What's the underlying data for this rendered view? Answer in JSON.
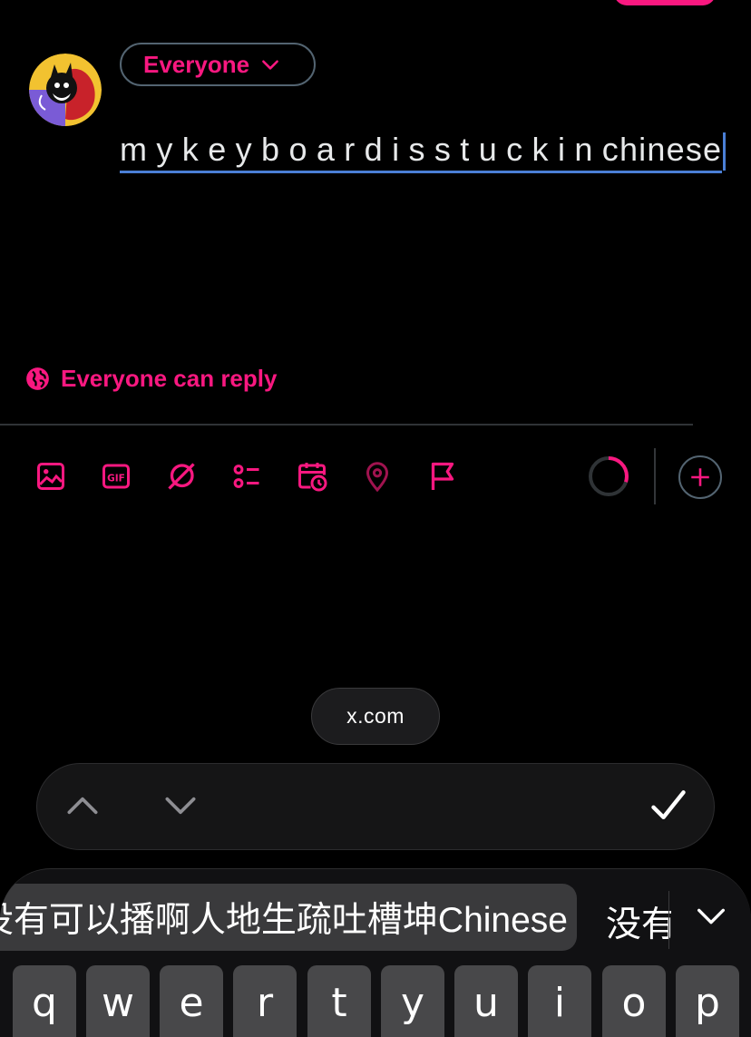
{
  "compose": {
    "audience_label": "Everyone",
    "text": "m y  k e y  b o a r d i s s  t u c  k i n  chinese",
    "reply_setting": "Everyone can reply"
  },
  "toolbar": {
    "tools": [
      "image-icon",
      "gif-icon",
      "grok-icon",
      "poll-icon",
      "schedule-icon",
      "location-icon",
      "flag-icon"
    ],
    "char_progress": 0.3
  },
  "browser": {
    "url": "x.com"
  },
  "keyboard": {
    "candidate_main": "没有可以播啊人地生疏吐槽坤Chinese",
    "candidate_alt": "没有",
    "keys": [
      "q",
      "w",
      "e",
      "r",
      "t",
      "y",
      "u",
      "i",
      "o",
      "p"
    ]
  },
  "colors": {
    "accent": "#f91880",
    "background": "#000000",
    "border": "#536471",
    "cursor": "#4a7fd6"
  }
}
